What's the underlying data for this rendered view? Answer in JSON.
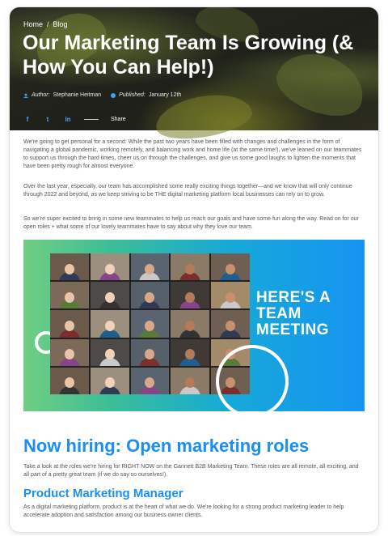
{
  "breadcrumb": {
    "home": "Home",
    "separator": "/",
    "current": "Blog"
  },
  "article": {
    "title": "Our Marketing Team Is Growing (& How You Can Help!)",
    "author_label": "Author:",
    "author": "Stephanie Heitman",
    "published_label": "Published:",
    "published": "January 12th",
    "share_label": "Share"
  },
  "social": {
    "facebook": "f",
    "twitter": "t",
    "linkedin": "in"
  },
  "paragraphs": [
    "We're going to get personal for a second: While the past two years have been filled with changes and challenges in the form of navigating a global pandemic, working remotely, and balancing work and home life (at the same time!), we've leaned on our teammates to support us through the hard times, cheer us on through the challenges, and give us some good laughs to lighten the moments that have been pretty rough for almost everyone.",
    "Over the last year, especially, our team has accomplished some really exciting things together—and we know that will only continue through 2022 and beyond, as we keep striving to be THE digital marketing platform local businesses can rely on to grow.",
    "So we're super excited to bring in some new teammates to help us reach our goals and have some fun along the way. Read on for our open roles + what some of our lovely teammates have to say about why they love our team."
  ],
  "meeting_image": {
    "line1": "HERE'S A",
    "line2": "TEAM",
    "line3": "MEETING"
  },
  "hiring": {
    "heading": "Now hiring: Open marketing roles",
    "intro": "Take a look at the roles we're hiring for RIGHT NOW on the Gannett B2B Marketing Team. These roles are all remote, all exciting, and all part of a pretty great team (if we do say so ourselves!).",
    "role_title": "Product Marketing Manager",
    "role_desc": "As a digital marketing platform, product is at the heart of what we do. We're looking for a strong product marketing leader to help accelerate adoption and satisfaction among our business owner clients."
  },
  "colors": {
    "accent": "#1a8ef2",
    "meeting_green": "#6fce82",
    "meeting_blue": "#1594f2"
  }
}
